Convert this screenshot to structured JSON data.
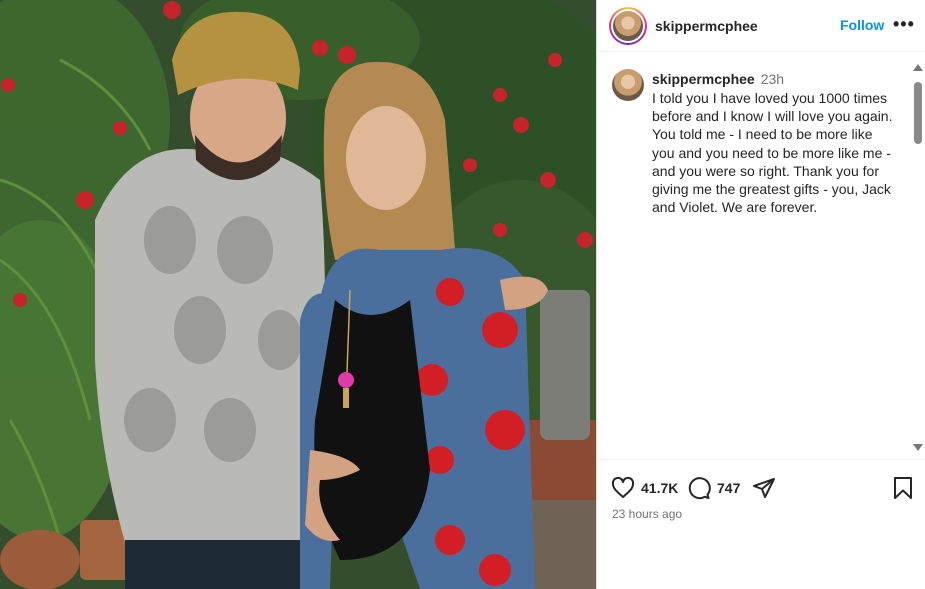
{
  "post": {
    "username": "skippermcphee",
    "follow_label": "Follow",
    "more_label": "•••",
    "caption_time": "23h",
    "caption_text": "I told you I have loved you 1000 times before and I know I will love you again. You told me - I need to be more like you and you need to be more like me - and you were so right.  Thank you for giving me the greatest gifts - you, Jack and Violet. We are forever.",
    "likes": "41.7K",
    "comments": "747",
    "posted_ago": "23 hours ago"
  },
  "icons": {
    "like": "heart-icon",
    "comment": "comment-bubble-icon",
    "share": "send-icon",
    "save": "bookmark-icon",
    "more": "more-dots-icon"
  },
  "colors": {
    "follow": "#0095f6",
    "text": "#262626",
    "secondary": "#737373"
  }
}
